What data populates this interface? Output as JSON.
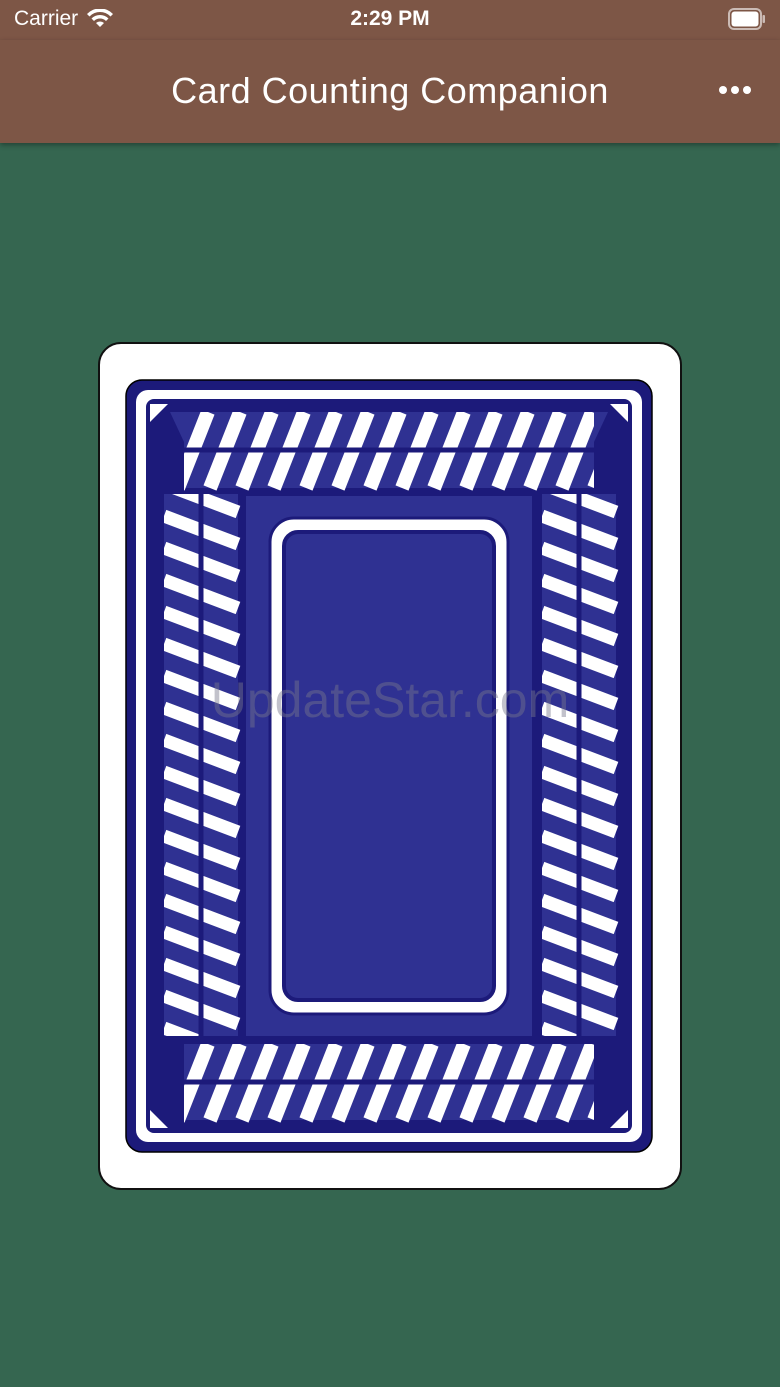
{
  "status_bar": {
    "carrier": "Carrier",
    "time": "2:29 PM",
    "wifi_icon": "wifi-icon",
    "battery_icon": "battery-icon"
  },
  "nav": {
    "title": "Card Counting Companion",
    "more_icon": "more-horizontal-icon"
  },
  "card": {
    "state": "face-down",
    "back_color": "#2f3192",
    "border_color": "#1c1a7a"
  },
  "watermark": "UpdateStar.com",
  "colors": {
    "nav_background": "#7d5646",
    "table_felt": "#356650"
  }
}
